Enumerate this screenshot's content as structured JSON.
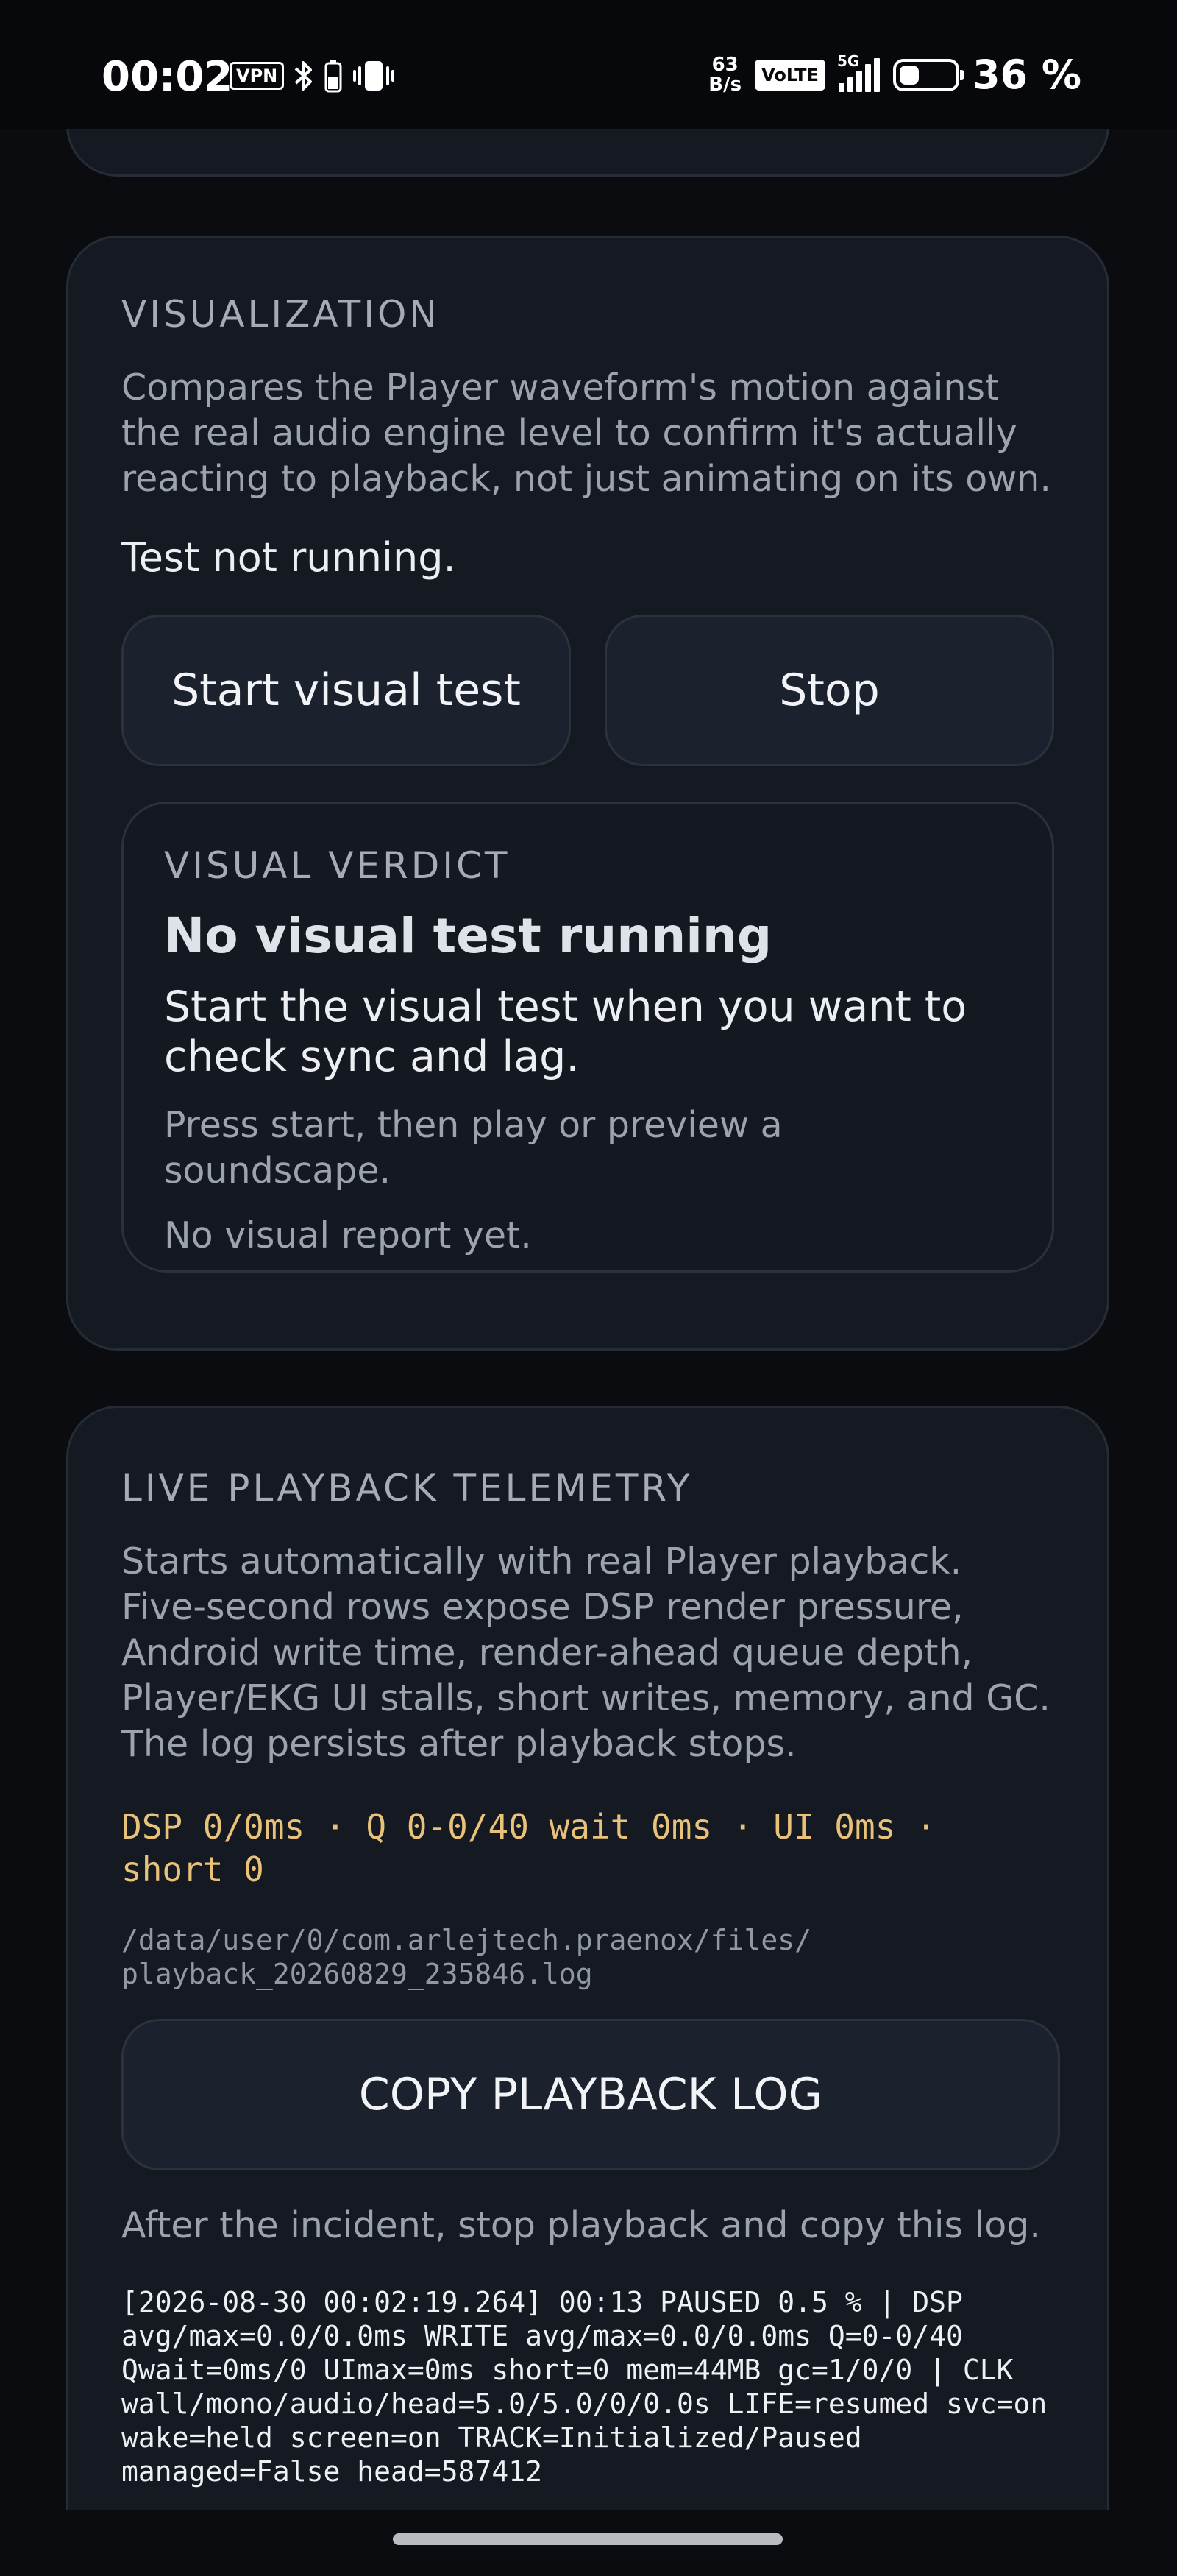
{
  "status_bar": {
    "time": "00:02",
    "vpn": "VPN",
    "net_speed_value": "63",
    "net_speed_unit": "B/s",
    "volte": "VoLTE",
    "network": "5G",
    "battery_level": 36,
    "battery_text": "36 %"
  },
  "visualization": {
    "label": "VISUALIZATION",
    "description": "Compares the Player waveform's motion against the real audio engine level to confirm it's actually reacting to playback, not just animating on its own.",
    "status": "Test not running.",
    "start_label": "Start visual test",
    "stop_label": "Stop",
    "verdict": {
      "label": "VISUAL VERDICT",
      "title": "No visual test running",
      "subtitle": "Start the visual test when you want to check sync and lag.",
      "hint": "Press start, then play or preview a soundscape.",
      "report": "No visual report yet."
    }
  },
  "telemetry": {
    "label": "LIVE PLAYBACK TELEMETRY",
    "description": "Starts automatically with real Player playback. Five-second rows expose DSP render pressure, Android write time, render-ahead queue depth, Player/EKG UI stalls, short writes, memory, and GC. The log persists after playback stops.",
    "metrics": "DSP 0/0ms · Q 0-0/40 wait 0ms · UI 0ms · short 0",
    "log_path": "/data/user/0/com.arlejtech.praenox/files/ playback_20260829_235846.log",
    "copy_label": "COPY PLAYBACK LOG",
    "hint": "After the incident, stop playback and copy this log.",
    "log_entry": "[2026-08-30 00:02:19.264] 00:13 PAUSED 0.5 % | DSP avg/max=0.0/0.0ms WRITE avg/max=0.0/0.0ms Q=0-0/40 Qwait=0ms/0 UImax=0ms short=0 mem=44MB gc=1/0/0 | CLK wall/mono/audio/head=5.0/5.0/0/0.0s LIFE=resumed svc=on wake=held screen=on TRACK=Initialized/Paused managed=False head=587412"
  },
  "colors": {
    "background": "#0a0c10",
    "card": "#151a22",
    "accent_metrics": "#e9c27a"
  }
}
